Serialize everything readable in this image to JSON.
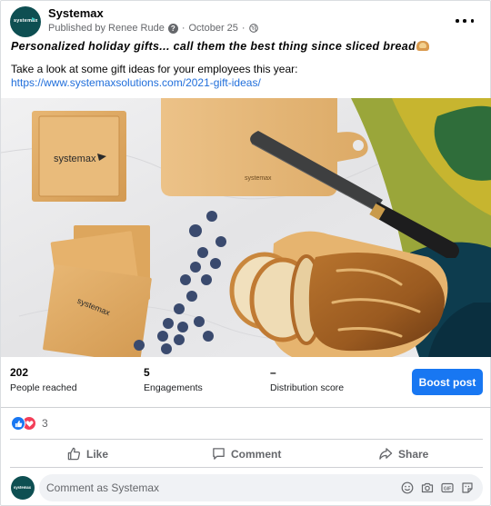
{
  "page": {
    "name": "Systemax",
    "avatar_text": "systemax"
  },
  "post": {
    "published_by": "Published by Renee Rude",
    "separator": "·",
    "date": "October 25",
    "date_separator": "·",
    "headline": "Personalized holiday gifts... call them the best thing since sliced bread",
    "body": "Take a look at some gift ideas for your employees this year:",
    "link": "https://www.systemaxsolutions.com/2021-gift-ideas/",
    "photo_brand_text": "systemax"
  },
  "stats": [
    {
      "value": "202",
      "label": "People reached"
    },
    {
      "value": "5",
      "label": "Engagements"
    },
    {
      "value": "–",
      "label": "Distribution score"
    }
  ],
  "boost_label": "Boost post",
  "reactions": {
    "count": "3",
    "types": [
      "like-icon",
      "love-icon"
    ]
  },
  "actions": {
    "like": "Like",
    "comment": "Comment",
    "share": "Share"
  },
  "comment": {
    "placeholder": "Comment as Systemax",
    "icons": [
      "emoji-icon",
      "camera-icon",
      "gif-icon",
      "sticker-icon"
    ]
  },
  "colors": {
    "primary": "#1877f2",
    "link": "#216fdb",
    "secondary_text": "#65676b",
    "avatar_bg": "#0e4f52",
    "love": "#f33e58"
  }
}
